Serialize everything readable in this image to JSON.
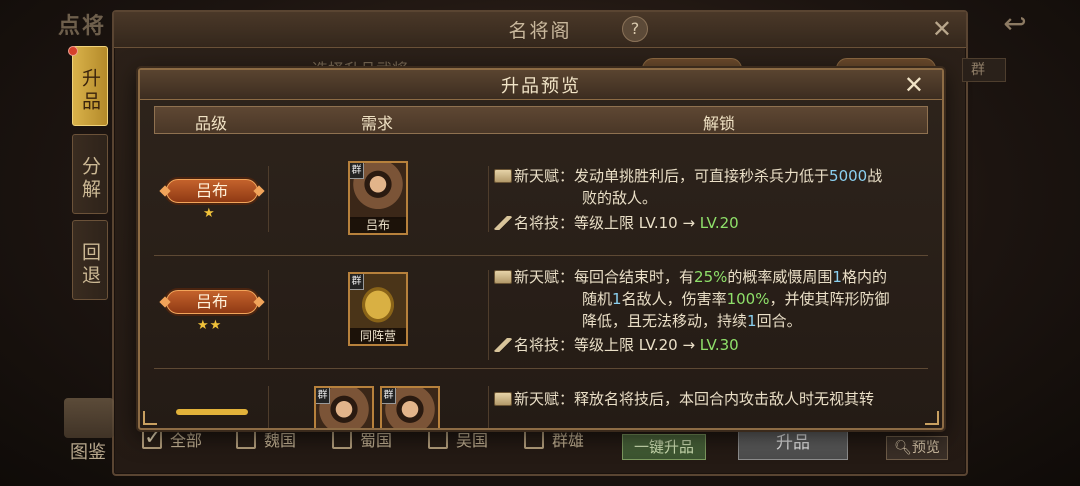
{
  "background": {
    "corner_title": "点将",
    "window_title": "名将阁",
    "help_label": "?",
    "close_label": "✕",
    "back_label": "↩",
    "subtitle": "选择升品武将",
    "faction_tag": "群",
    "side_tabs": [
      "升品",
      "分解",
      "回退"
    ],
    "album_label": "图鉴",
    "filters": [
      {
        "label": "全部",
        "checked": true
      },
      {
        "label": "魏国",
        "checked": false
      },
      {
        "label": "蜀国",
        "checked": false
      },
      {
        "label": "吴国",
        "checked": false
      },
      {
        "label": "群雄",
        "checked": false
      }
    ],
    "onekey_button": "一键升品",
    "upgrade_button": "升品",
    "preview_button": "预览"
  },
  "modal": {
    "title": "升品预览",
    "close_label": "✕",
    "columns": {
      "grade": "品级",
      "requirement": "需求",
      "unlock": "解锁"
    },
    "rows": [
      {
        "grade_name": "吕布",
        "stars": "★",
        "req_faction": "群",
        "req_name": "吕布",
        "talent_label": "新天赋：",
        "talent_part1": "发动单挑胜利后，可直接秒杀兵力低于",
        "talent_num": "5000",
        "talent_part2": "战",
        "talent_line2": "败的敌人。",
        "skill_label": "名将技：",
        "skill_text": "等级上限 LV.10 → ",
        "skill_new": "LV.20"
      },
      {
        "grade_name": "吕布",
        "stars": "★★",
        "req_faction": "群",
        "req_name": "同阵营",
        "talent_label": "新天赋：",
        "talent_a": "每回合结束时，有",
        "talent_b": "25%",
        "talent_c": "的概率威慑周围",
        "talent_d": "1",
        "talent_e": "格内的",
        "talent_f": "随机",
        "talent_g": "1",
        "talent_h": "名敌人，伤害率",
        "talent_i": "100%",
        "talent_j": "，并使其阵形防御",
        "talent_k": "降低，且无法移动，持续",
        "talent_l": "1",
        "talent_m": "回合。",
        "skill_label": "名将技：",
        "skill_text": "等级上限 LV.20 → ",
        "skill_new": "LV.30"
      },
      {
        "req_faction": "群",
        "talent_label": "新天赋：",
        "talent_text": "释放名将技后，本回合内攻击敌人时无视其转"
      }
    ]
  }
}
